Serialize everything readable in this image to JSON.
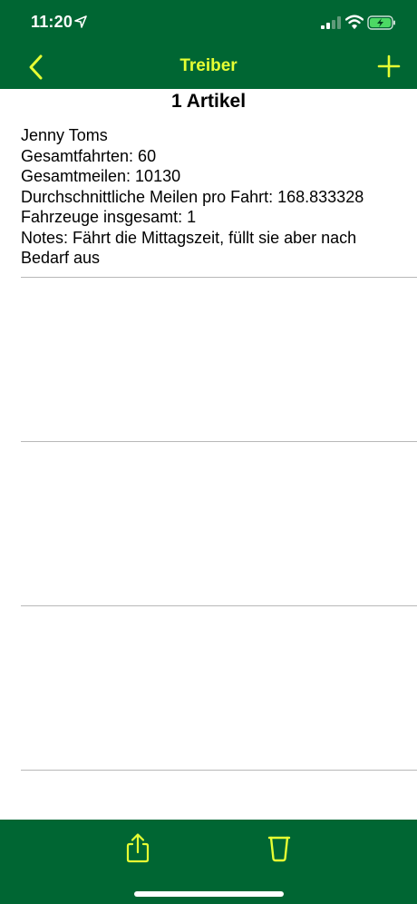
{
  "status": {
    "time": "11:20",
    "icons": [
      "location-arrow-icon",
      "cellular-signal-icon",
      "wifi-icon",
      "battery-charging-icon"
    ]
  },
  "nav": {
    "title": "Treiber",
    "back_icon": "chevron-left-icon",
    "add_icon": "plus-icon"
  },
  "list": {
    "header": "1 Artikel",
    "items": [
      {
        "name": "Jenny Toms",
        "total_trips": "Gesamtfahrten: 60",
        "total_miles": "Gesamtmeilen: 10130",
        "avg_miles": "Durchschnittliche Meilen pro Fahrt: 168.833328",
        "total_vehicles": "Fahrzeuge insgesamt: 1",
        "notes": "Notes: Fährt die Mittagszeit, füllt sie aber nach Bedarf aus"
      }
    ]
  },
  "toolbar": {
    "share_icon": "share-icon",
    "trash_icon": "trash-icon"
  },
  "colors": {
    "bar_background": "#006633",
    "accent": "#e6ff33",
    "separator": "#b8b8b8"
  }
}
